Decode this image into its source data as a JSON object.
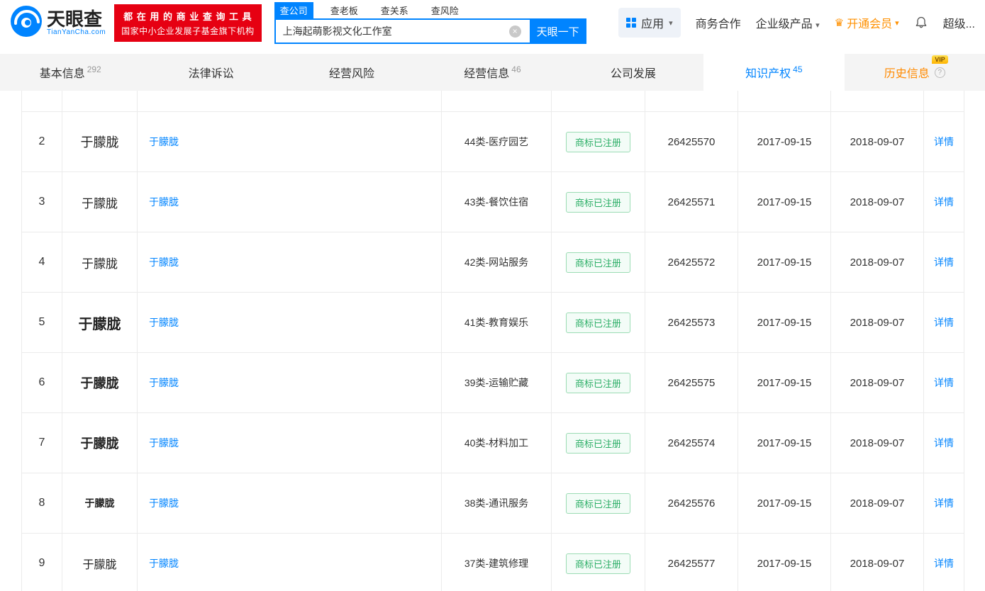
{
  "colors": {
    "accent_blue": "#0084ff",
    "promo_red": "#e60012",
    "member_orange": "#ff9000",
    "history_tab_orange": "#ff8a00",
    "status_green": "#2bae66"
  },
  "icons": {
    "clear_search": "×",
    "dropdown_caret": "▾",
    "crown": "♛",
    "help": "?",
    "vip": "VIP"
  },
  "header": {
    "logo_title": "天眼查",
    "logo_subtitle": "TianYanCha.com",
    "promo_line1": "都 在 用 的 商 业 查 询 工 具",
    "promo_line2": "国家中小企业发展子基金旗下机构",
    "search_tabs": [
      {
        "label": "查公司"
      },
      {
        "label": "查老板"
      },
      {
        "label": "查关系"
      },
      {
        "label": "查风险"
      }
    ],
    "search_value": "上海起萌影视文化工作室",
    "search_button": "天眼一下",
    "right_menu": {
      "apps": "应用",
      "business": "商务合作",
      "enterprise": "企业级产品",
      "member": "开通会员",
      "super": "超级..."
    }
  },
  "tabs": [
    {
      "label": "基本信息",
      "count": "292"
    },
    {
      "label": "法律诉讼",
      "count": ""
    },
    {
      "label": "经营风险",
      "count": ""
    },
    {
      "label": "经营信息",
      "count": "46"
    },
    {
      "label": "公司发展",
      "count": ""
    },
    {
      "label": "知识产权",
      "count": "45"
    },
    {
      "label": "历史信息",
      "count": "",
      "vip_label": "VIP"
    }
  ],
  "table": {
    "rows": [
      {
        "num": "2",
        "mark": "于朦胧",
        "name": "于朦胧",
        "category": "44类-医疗园艺",
        "status": "商标已注册",
        "reg_no": "26425570",
        "app_date": "2017-09-15",
        "reg_date": "2018-09-07",
        "detail": "详情",
        "mark_size": 18,
        "mark_weight": 500
      },
      {
        "num": "3",
        "mark": "于朦胧",
        "name": "于朦胧",
        "category": "43类-餐饮住宿",
        "status": "商标已注册",
        "reg_no": "26425571",
        "app_date": "2017-09-15",
        "reg_date": "2018-09-07",
        "detail": "详情",
        "mark_size": 17,
        "mark_weight": 400
      },
      {
        "num": "4",
        "mark": "于朦胧",
        "name": "于朦胧",
        "category": "42类-网站服务",
        "status": "商标已注册",
        "reg_no": "26425572",
        "app_date": "2017-09-15",
        "reg_date": "2018-09-07",
        "detail": "详情",
        "mark_size": 17,
        "mark_weight": 400
      },
      {
        "num": "5",
        "mark": "于朦胧",
        "name": "于朦胧",
        "category": "41类-教育娱乐",
        "status": "商标已注册",
        "reg_no": "26425573",
        "app_date": "2017-09-15",
        "reg_date": "2018-09-07",
        "detail": "详情",
        "mark_size": 20,
        "mark_weight": 700
      },
      {
        "num": "6",
        "mark": "于朦胧",
        "name": "于朦胧",
        "category": "39类-运输贮藏",
        "status": "商标已注册",
        "reg_no": "26425575",
        "app_date": "2017-09-15",
        "reg_date": "2018-09-07",
        "detail": "详情",
        "mark_size": 18,
        "mark_weight": 600
      },
      {
        "num": "7",
        "mark": "于朦胧",
        "name": "于朦胧",
        "category": "40类-材料加工",
        "status": "商标已注册",
        "reg_no": "26425574",
        "app_date": "2017-09-15",
        "reg_date": "2018-09-07",
        "detail": "详情",
        "mark_size": 18,
        "mark_weight": 600
      },
      {
        "num": "8",
        "mark": "于朦胧",
        "name": "于朦胧",
        "category": "38类-通讯服务",
        "status": "商标已注册",
        "reg_no": "26425576",
        "app_date": "2017-09-15",
        "reg_date": "2018-09-07",
        "detail": "详情",
        "mark_size": 14,
        "mark_weight": 700
      },
      {
        "num": "9",
        "mark": "于朦胧",
        "name": "于朦胧",
        "category": "37类-建筑修理",
        "status": "商标已注册",
        "reg_no": "26425577",
        "app_date": "2017-09-15",
        "reg_date": "2018-09-07",
        "detail": "详情",
        "mark_size": 16,
        "mark_weight": 400
      }
    ]
  }
}
